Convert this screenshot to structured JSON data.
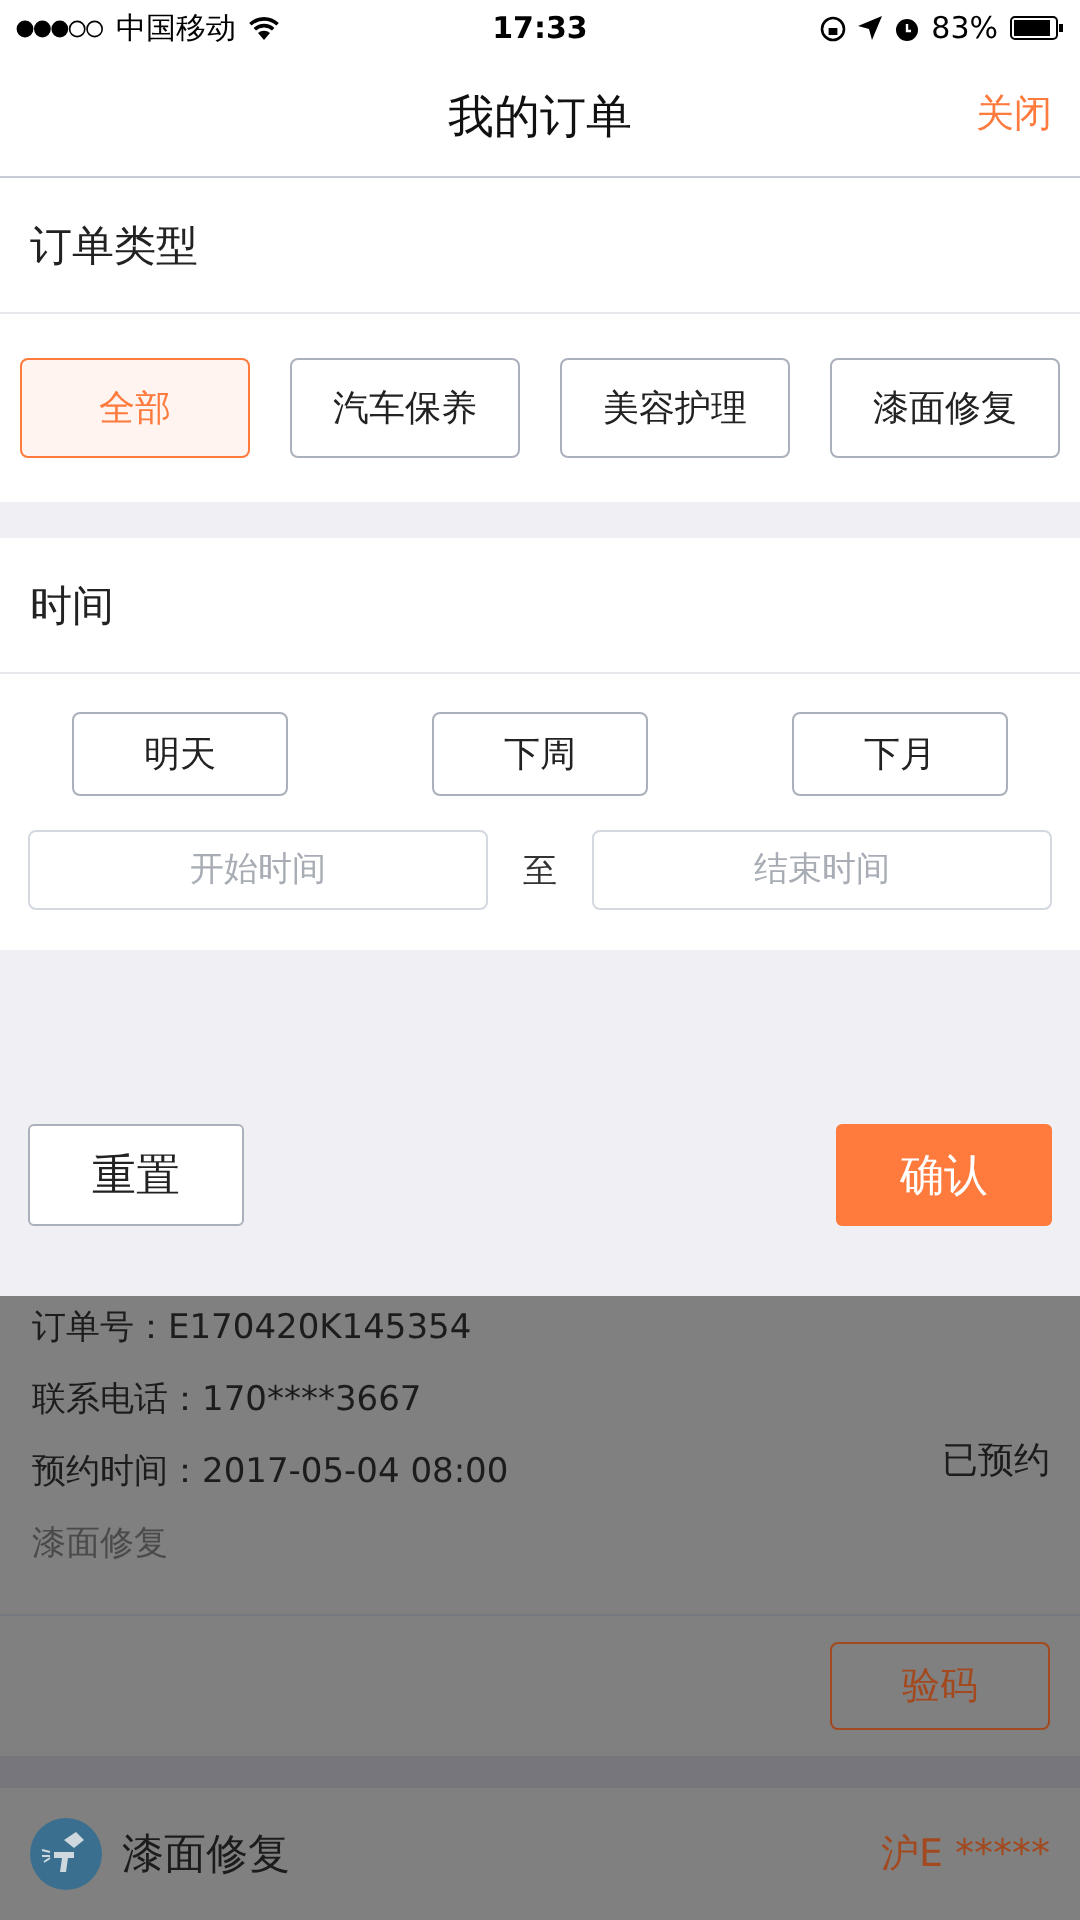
{
  "status_bar": {
    "carrier": "中国移动",
    "time": "17:33",
    "battery": "83%"
  },
  "nav": {
    "title": "我的订单",
    "close": "关闭"
  },
  "order_type": {
    "title": "订单类型",
    "options": [
      {
        "label": "全部",
        "selected": true
      },
      {
        "label": "汽车保养",
        "selected": false
      },
      {
        "label": "美容护理",
        "selected": false
      },
      {
        "label": "漆面修复",
        "selected": false
      }
    ]
  },
  "time": {
    "title": "时间",
    "options": [
      {
        "label": "明天",
        "selected": false
      },
      {
        "label": "下周",
        "selected": false
      },
      {
        "label": "下月",
        "selected": false
      }
    ],
    "start": {
      "placeholder": "开始时间"
    },
    "separator": "至",
    "end": {
      "placeholder": "结束时间"
    }
  },
  "actions": {
    "reset": "重置",
    "confirm": "确认"
  },
  "order": {
    "number": "订单号：E170420K145354",
    "phone": "联系电话：170****3667",
    "appointment": "预约时间：2017-05-04 08:00",
    "service": "漆面修复",
    "status": "已预约",
    "button": "验码"
  },
  "next_order": {
    "service": "漆面修复",
    "plate": "沪E *****"
  }
}
